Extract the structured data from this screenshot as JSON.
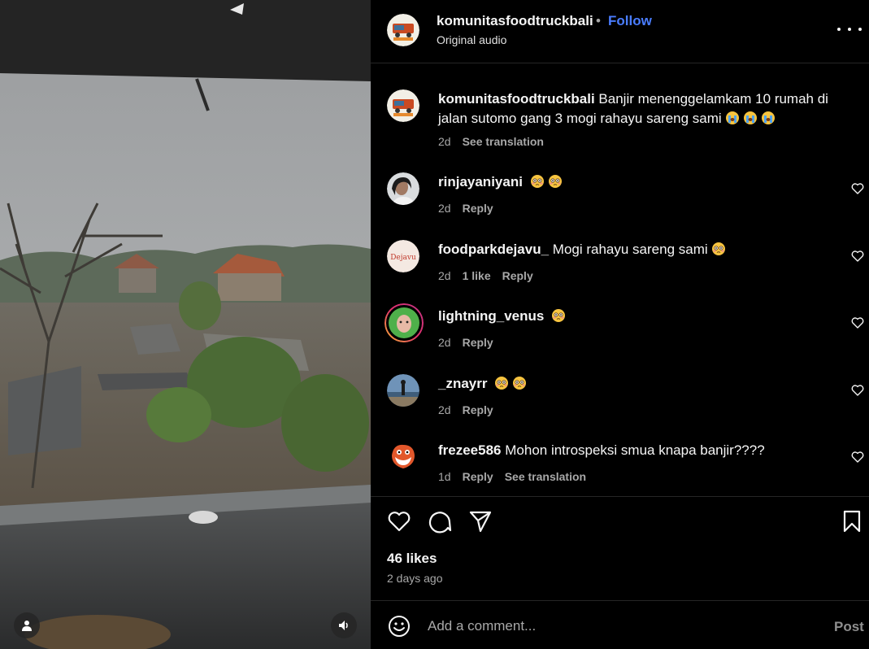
{
  "post": {
    "username": "komunitasfoodtruckbali",
    "separator": "•",
    "follow_label": "Follow",
    "audio": "Original audio",
    "more_icon": "more-horizontal-icon"
  },
  "caption": {
    "username": "komunitasfoodtruckbali",
    "text": "Banjir menenggelamkam 10 rumah di jalan sutomo gang 3 mogi rahayu sareng sami",
    "emojis": [
      "crying-face",
      "crying-face",
      "crying-face"
    ],
    "time": "2d",
    "translation_label": "See translation"
  },
  "comments": [
    {
      "username": "rinjayaniyani",
      "text": "",
      "emojis": [
        "flushed-face",
        "flushed-face"
      ],
      "time": "2d",
      "likes": "",
      "reply_label": "Reply",
      "translation_label": ""
    },
    {
      "username": "foodparkdejavu_",
      "text": "Mogi rahayu sareng sami",
      "emojis": [
        "flushed-face"
      ],
      "time": "2d",
      "likes": "1 like",
      "reply_label": "Reply",
      "translation_label": "",
      "avatar_text": "Dejavu"
    },
    {
      "username": "lightning_venus",
      "text": "",
      "emojis": [
        "flushed-face"
      ],
      "time": "2d",
      "likes": "",
      "reply_label": "Reply",
      "translation_label": ""
    },
    {
      "username": "_znayrr",
      "text": "",
      "emojis": [
        "flushed-face",
        "flushed-face"
      ],
      "time": "2d",
      "likes": "",
      "reply_label": "Reply",
      "translation_label": ""
    },
    {
      "username": "frezee586",
      "text": "Mohon introspeksi smua knapa banjir????",
      "emojis": [],
      "time": "1d",
      "likes": "",
      "reply_label": "Reply",
      "translation_label": "See translation"
    }
  ],
  "actions": {
    "like_icon": "heart-icon",
    "comment_icon": "comment-icon",
    "share_icon": "share-icon",
    "save_icon": "bookmark-icon"
  },
  "likes_text": "46 likes",
  "posted_time": "2 days ago",
  "comment_box": {
    "placeholder": "Add a comment...",
    "post_label": "Post",
    "emoji_icon": "smile-icon"
  },
  "media": {
    "user_icon": "user-icon",
    "audio_icon": "speaker-icon"
  },
  "colors": {
    "background": "#000000",
    "accent": "#4a7dff",
    "secondary_text": "#a8a8a8",
    "divider": "#262626"
  }
}
